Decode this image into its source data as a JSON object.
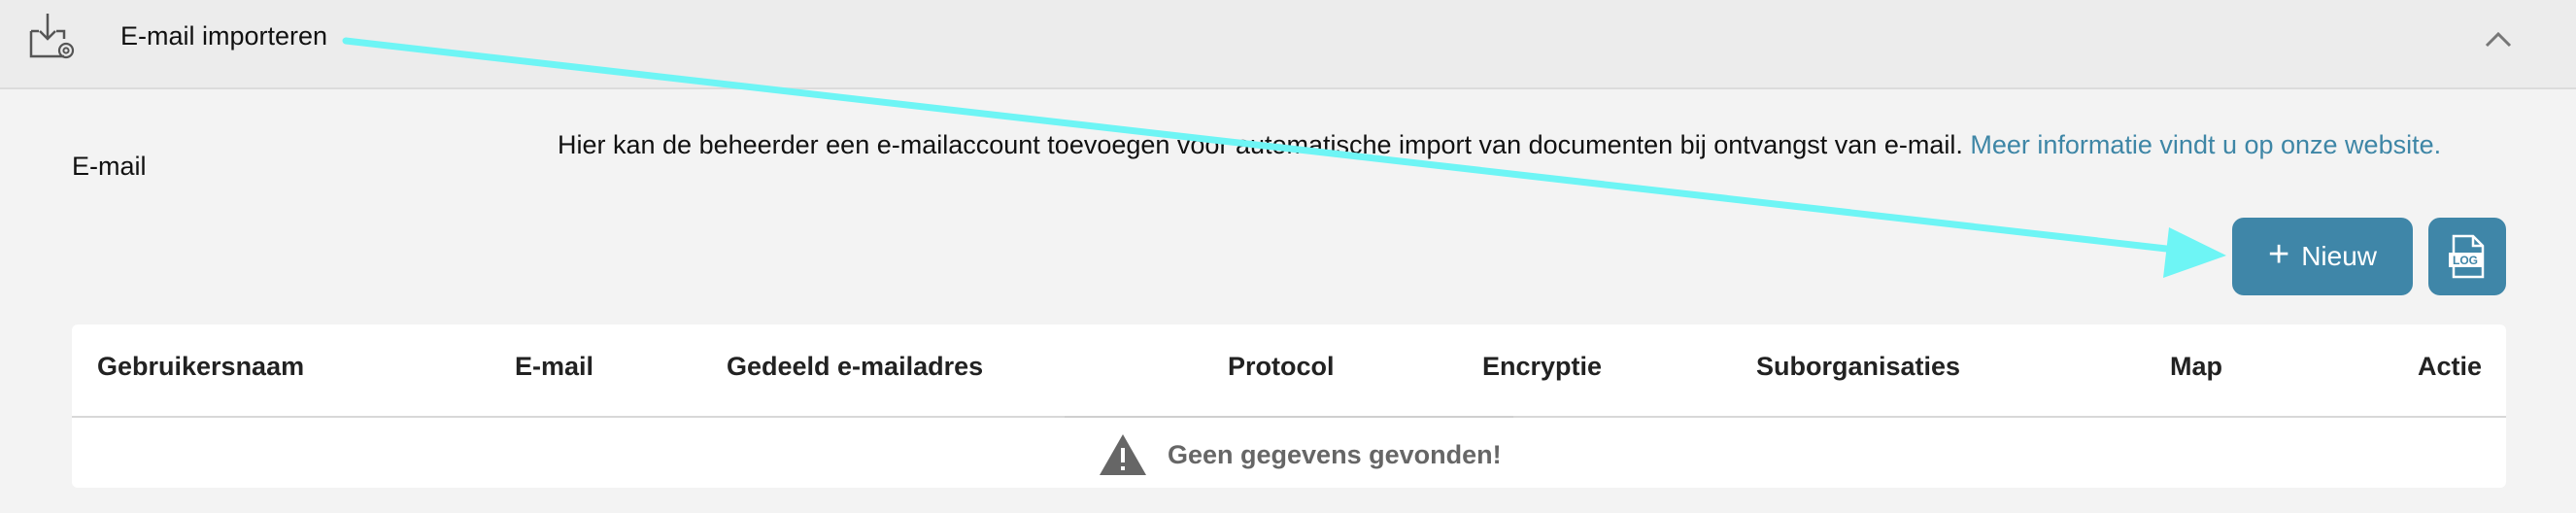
{
  "header": {
    "title": "E-mail importeren",
    "icon": "inbox-download-at-icon",
    "collapse_icon": "chevron-up-icon"
  },
  "section": {
    "label": "E-mail",
    "description": "Hier kan de beheerder een e-mailaccount toevoegen voor automatische import van documenten bij ontvangst van e-mail.",
    "link_text": "Meer informatie vindt u op onze website."
  },
  "toolbar": {
    "new_label": "Nieuw",
    "log_label": "LOG"
  },
  "table": {
    "columns": [
      "Gebruikersnaam",
      "E-mail",
      "Gedeeld e-mailadres",
      "Protocol",
      "Encryptie",
      "Suborganisaties",
      "Map",
      "Actie"
    ],
    "empty_message": "Geen gegevens gevonden!"
  },
  "colors": {
    "accent": "#3f86a8",
    "link": "#3e86a6",
    "annotation_arrow": "#6ef5f5"
  }
}
